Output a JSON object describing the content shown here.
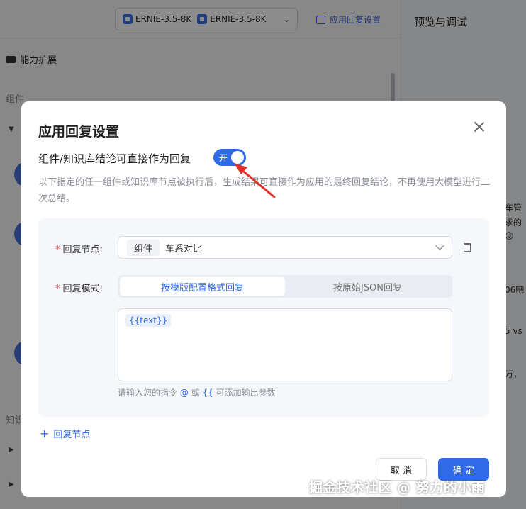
{
  "background": {
    "models": [
      "ERNIE-3.5-8K",
      "ERNIE-3.5-8K"
    ],
    "reply_setting_link": "应用回复设置",
    "preview_title": "预览与调试",
    "ability_label": "能力扩展",
    "component_label": "组件",
    "knowledge_label": "知识",
    "right_snippets": [
      "车管",
      "求的",
      "😜",
      "06吧",
      "5 vs",
      "万，"
    ]
  },
  "modal": {
    "title": "应用回复设置",
    "toggle_label": "组件/知识库结论可直接作为回复",
    "toggle_state": "开",
    "description": "以下指定的任一组件或知识库节点被执行后，生成结果可直接作为应用的最终回复结论，不再使用大模型进行二次总结。",
    "reply_node": {
      "label": "回复节点:",
      "tag": "组件",
      "value": "车系对比"
    },
    "reply_mode": {
      "label": "回复模式:",
      "options": [
        "按模版配置格式回复",
        "按原始JSON回复"
      ],
      "selected_index": 0
    },
    "template_chip": "{{text}}",
    "hint": {
      "prefix": "请输入您的指令",
      "at": "@",
      "or": "或",
      "braces": "{{",
      "suffix": "可添加输出参数"
    },
    "add_node": "回复节点",
    "cancel": "取 消",
    "confirm": "确 定"
  },
  "watermark": "掘金技术社区 @ 努力的小雨",
  "colors": {
    "primary": "#2f6ae8",
    "required": "#e5484d",
    "arrow": "#e0302a"
  }
}
